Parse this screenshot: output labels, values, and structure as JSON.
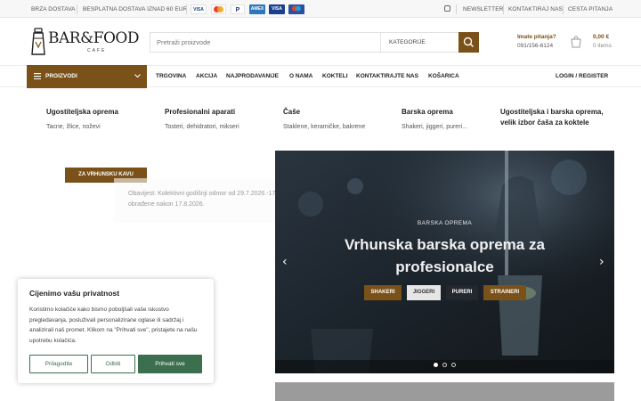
{
  "topbar": {
    "fast_delivery": "BRZA DOSTAVA",
    "free_shipping": "BESPLATNA DOSTAVA IZNAD 60 EUR",
    "payment_icons": [
      {
        "name": "visa",
        "label": "VISA",
        "color": "#ffffff",
        "text_color": "#1a3f8f"
      },
      {
        "name": "mastercard",
        "label": "MC",
        "color": "#e3442b",
        "text_color": "#ffffff"
      },
      {
        "name": "paypal",
        "label": "P",
        "color": "#ffffff",
        "text_color": "#1f3b8a"
      },
      {
        "name": "amex",
        "label": "AMEX",
        "color": "#2e77bb",
        "text_color": "#ffffff"
      },
      {
        "name": "visa-electron",
        "label": "VISA",
        "color": "#1a3f8f",
        "text_color": "#ffffff"
      },
      {
        "name": "maestro",
        "label": "M",
        "color": "#2d4f9e",
        "text_color": "#ffffff"
      }
    ],
    "newsletter": "NEWSLETTER",
    "contact": "KONTAKTIRAJ NAS",
    "faq": "CESTA PITANJA"
  },
  "header": {
    "logo_text": "BAR&FOOD",
    "logo_sub": "CAFE",
    "search_placeholder": "Pretraži proizvode",
    "category_label": "KATEGORIJE",
    "help_question": "Imate pitanja?",
    "help_phone": "091/156-6124",
    "cart_amount": "0,00 €",
    "cart_count": "0 items"
  },
  "nav": {
    "products": "PROIZVODI",
    "links": [
      "TRGOVINA",
      "AKCIJA",
      "NAJPRODAVANIJE",
      "O NAMA",
      "KOKTELI",
      "KONTAKTIRAJTE NAS",
      "KOŠARICA"
    ],
    "login": "LOGIN / REGISTER"
  },
  "megamenu": [
    {
      "title": "Ugostiteljska oprema",
      "sub": "Tacne, žlice, noževi"
    },
    {
      "title": "Profesionalni aparati",
      "sub": "Tosteri, dehidratori, mikseri"
    },
    {
      "title": "Čaše",
      "sub": "Staklene, keramičke, bakrene"
    },
    {
      "title": "Barska oprema",
      "sub": "Shakeri, jiggeri, pureri..."
    },
    {
      "title": "Ugostiteljska i barska oprema, velik izbor čaša za koktele",
      "sub": ""
    }
  ],
  "content": {
    "promo_tag": "ZA VRHUNSKU KAVU",
    "notice": "Obavijest: Kolektivni godišnji odmor od 29.7.2026.-17.8.2026. Narudžbe zaprimljene u tom periodu bit će obrađene nakon 17.8.2026."
  },
  "hero": {
    "eyebrow": "BARSKA OPREMA",
    "title": "Vrhunska barska oprema za profesionalce",
    "buttons": [
      {
        "label": "SHAKERI",
        "style": "brown"
      },
      {
        "label": "JIGGERI",
        "style": "light"
      },
      {
        "label": "PURERI",
        "style": "dark"
      },
      {
        "label": "STRAINERI",
        "style": "brown"
      }
    ],
    "prev": "‹",
    "next": "›",
    "slide_count": 3,
    "active_slide": 1
  },
  "cookie": {
    "title": "Cijenimo vašu privatnost",
    "text": "Koristimo kolačiće kako bismo poboljšali vaše iskustvo pregledavanja, posluživali personalizirane oglase ili sadržaj i analizirali naš promet. Klikom na \"Prihvati sve\", pristajete na našu upotrebu kolačića.",
    "customize": "Prilagodite",
    "reject": "Odbiti",
    "accept": "Prihvati sve"
  },
  "colors": {
    "brand": "#7a5119",
    "cookie_green": "#3b6f4e"
  }
}
